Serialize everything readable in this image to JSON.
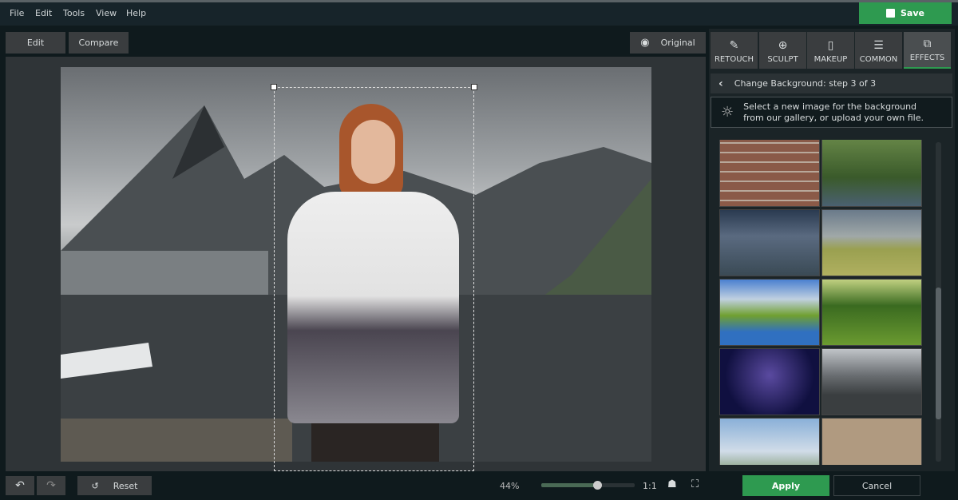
{
  "menu": [
    "File",
    "Edit",
    "Tools",
    "View",
    "Help"
  ],
  "save_label": "Save",
  "view_buttons": {
    "edit": "Edit",
    "compare": "Compare",
    "original": "Original"
  },
  "tabs": [
    {
      "label": "RETOUCH",
      "icon": "retouch-icon"
    },
    {
      "label": "SCULPT",
      "icon": "sculpt-icon"
    },
    {
      "label": "MAKEUP",
      "icon": "makeup-icon"
    },
    {
      "label": "COMMON",
      "icon": "sliders-icon"
    },
    {
      "label": "EFFECTS",
      "icon": "effects-icon",
      "active": true
    }
  ],
  "panel": {
    "step_title": "Change Background: step 3 of 3",
    "hint": "Select a new image for the background from our gallery, or upload your own file."
  },
  "gallery": [
    "brick-wall",
    "canal-bicycle",
    "stormy-city",
    "rainbow-field",
    "mountain-lake",
    "forest-sunlight",
    "starry-sky",
    "mountain-harbor",
    "castle-mountains",
    "burlap-texture"
  ],
  "bottom": {
    "reset": "Reset",
    "zoom": "44%",
    "zoom_fraction": 0.6,
    "one_to_one": "1:1",
    "apply": "Apply",
    "cancel": "Cancel"
  },
  "colors": {
    "accent": "#2e9a50"
  }
}
